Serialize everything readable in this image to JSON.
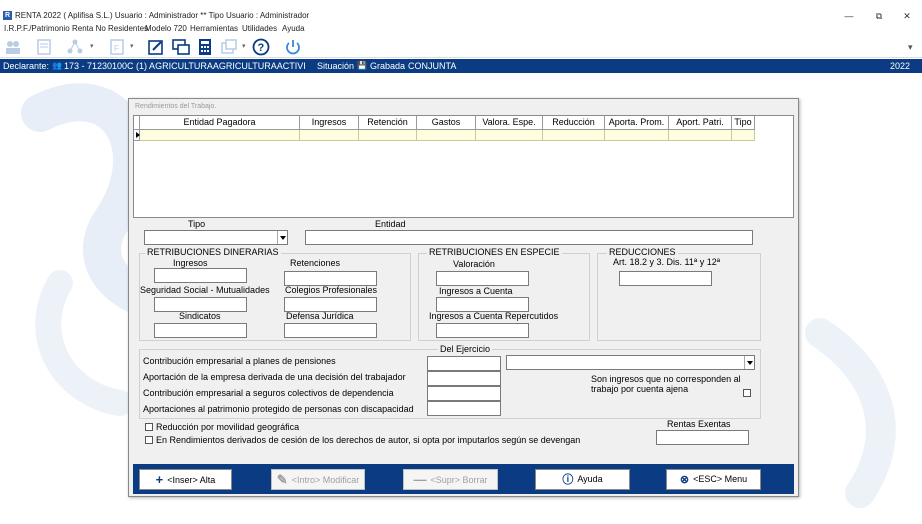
{
  "window": {
    "title": "RENTA 2022 ( Aplifisa S.L.) Usuario : Administrador  **  Tipo Usuario : Administrador",
    "app_icon_letter": "R"
  },
  "menu": [
    "I.R.P.F./Patrimonio",
    "Renta No Residentes",
    "Modelo 720",
    "Herramientas",
    "Utilidades",
    "Ayuda"
  ],
  "status": {
    "declarante_label": "Declarante:",
    "declarante_value": "173 - 71230100C  (1)  AGRICULTURAAGRICULTURAACTIVI",
    "situacion_label": "Situación",
    "situacion_value": "Grabada",
    "tipo": "CONJUNTA",
    "year": "2022"
  },
  "dialog": {
    "title": "Rendimientos del Trabajo.",
    "grid_columns": [
      "Entidad Pagadora",
      "Ingresos",
      "Retención",
      "Gastos",
      "Valora. Espe.",
      "Reducción",
      "Aporta. Prom.",
      "Aport. Patri.",
      "Tipo"
    ],
    "tipo_label": "Tipo",
    "tipo_value": "",
    "entidad_label": "Entidad",
    "entidad_value": "",
    "dinerarias": {
      "title": "RETRIBUCIONES DINERARIAS",
      "ingresos": "Ingresos",
      "retenciones": "Retenciones",
      "seguridad_social": "Seguridad Social - Mutualidades",
      "colegios": "Colegios Profesionales",
      "sindicatos": "Sindicatos",
      "defensa": "Defensa Jurídica"
    },
    "especie": {
      "title": "RETRIBUCIONES EN ESPECIE",
      "valoracion": "Valoración",
      "ingresos_cuenta": "Ingresos a Cuenta",
      "ingresos_cuenta_rep": "Ingresos a Cuenta Repercutidos"
    },
    "reducciones": {
      "title": "REDUCCIONES",
      "art": "Art. 18.2 y 3. Dis. 11ª y 12ª"
    },
    "del_ejercicio": "Del Ejercicio",
    "contrib_lines": [
      "Contribución empresarial a planes de pensiones",
      "Aportación de la empresa derivada de una decisión del trabajador",
      "Contribución empresarial a seguros colectivos de dependencia",
      "Aportaciones al patrimonio protegido de personas con discapacidad"
    ],
    "son_ingresos": [
      "Son ingresos  que no corresponden al",
      "trabajo por cuenta ajena"
    ],
    "reduccion_movilidad": "Reducción por movilidad geográfica",
    "rendimientos_autor": "En Rendimientos derivados de cesión de los derechos de autor, si opta por imputarlos según se devengan",
    "rentas_exentas": "Rentas Exentas",
    "buttons": {
      "alta": "<Inser> Alta",
      "modificar": "<Intro> Modificar",
      "borrar": "<Supr> Borrar",
      "ayuda": "Ayuda",
      "menu": "<ESC> Menu"
    }
  }
}
